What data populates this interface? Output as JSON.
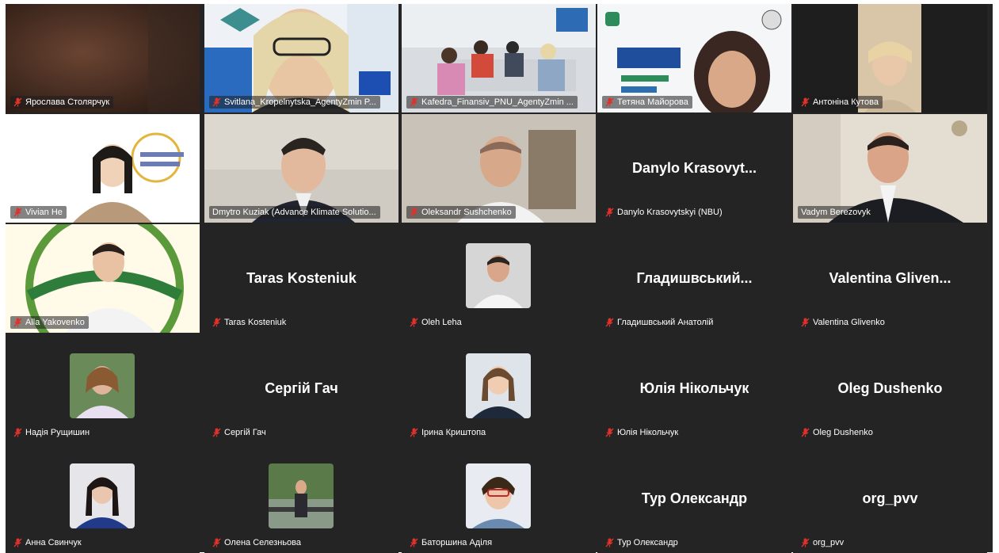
{
  "meeting": {
    "layout": "gallery",
    "active_speaker_border_color": "#27c24a",
    "muted_icon_color": "#e0312b"
  },
  "participants": [
    {
      "label": "Ярослава Столярчук",
      "big_name": "",
      "video": true
    },
    {
      "label": "Svitlana_Kropelnytska_AgentyZmin P...",
      "big_name": "",
      "video": true
    },
    {
      "label": "Kafedra_Finansiv_PNU_AgentyZmin ...",
      "big_name": "",
      "video": true
    },
    {
      "label": "Тетяна Майорова",
      "big_name": "",
      "video": true
    },
    {
      "label": "Антоніна Кутова",
      "big_name": "",
      "video": true
    },
    {
      "label": "Vivian He",
      "big_name": "",
      "video": true
    },
    {
      "label": "Dmytro Kuziak (Advance Klimate Solutio...",
      "big_name": "",
      "video": true
    },
    {
      "label": "Oleksandr Sushchenko",
      "big_name": "",
      "video": true
    },
    {
      "label": "Danylo Krasovytskyi (NBU)",
      "big_name": "Danylo  Krasovyt...",
      "video": false
    },
    {
      "label": "Vadym Berezovyk",
      "big_name": "",
      "video": true,
      "active_speaker": true
    },
    {
      "label": "Alla Yakovenko",
      "big_name": "",
      "video": true
    },
    {
      "label": "Taras Kosteniuk",
      "big_name": "Taras Kosteniuk",
      "video": false
    },
    {
      "label": "Oleh Leha",
      "big_name": "",
      "video": false,
      "avatar": true
    },
    {
      "label": "Гладишвський  Анатолій",
      "big_name": "Гладишвський...",
      "video": false
    },
    {
      "label": "Valentina Glivenko",
      "big_name": "Valentina  Gliven...",
      "video": false
    },
    {
      "label": "Надія Рущишин",
      "big_name": "",
      "video": false,
      "avatar": true
    },
    {
      "label": "Сергій Гач",
      "big_name": "Сергій Гач",
      "video": false
    },
    {
      "label": "Ірина Криштопа",
      "big_name": "",
      "video": false,
      "avatar": true
    },
    {
      "label": "Юлія Нікольчук",
      "big_name": "Юлія Нікольчук",
      "video": false
    },
    {
      "label": "Oleg Dushenko",
      "big_name": "Oleg Dushenko",
      "video": false
    },
    {
      "label": "Анна Свинчук",
      "big_name": "",
      "video": false,
      "avatar": true
    },
    {
      "label": "Олена Селезньова",
      "big_name": "",
      "video": false,
      "avatar": true
    },
    {
      "label": "Баторшина Аділя",
      "big_name": "",
      "video": false,
      "avatar": true
    },
    {
      "label": "Тур Олександр",
      "big_name": "Тур Олександр",
      "video": false
    },
    {
      "label": "org_pvv",
      "big_name": "org_pvv",
      "video": false
    }
  ]
}
